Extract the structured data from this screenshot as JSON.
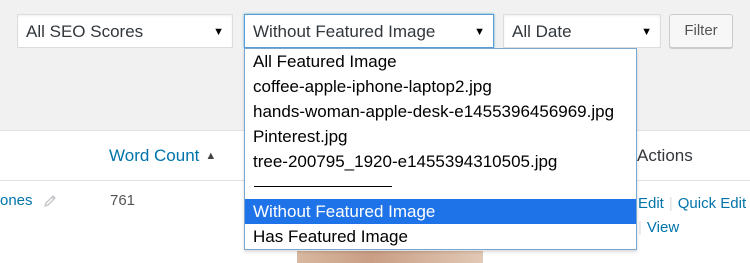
{
  "filters": {
    "seo_select": "All SEO Scores",
    "featured_select": "Without Featured Image",
    "date_select": "All Date",
    "filter_button": "Filter"
  },
  "dropdown": {
    "options": [
      "All Featured Image",
      "coffee-apple-iphone-laptop2.jpg",
      "hands-woman-apple-desk-e1455396456969.jpg",
      "Pinterest.jpg",
      "tree-200795_1920-e1455394310505.jpg",
      "───────────────",
      "Without Featured Image",
      "Has Featured Image"
    ],
    "selected_option": "Without Featured Image"
  },
  "table": {
    "columns": {
      "word_count": "Word Count",
      "actions": "Actions"
    },
    "row": {
      "title_fragment": "ones",
      "word_count": "761",
      "actions": [
        "Edit",
        "Quick Edit",
        "View"
      ]
    }
  },
  "colors": {
    "link": "#0073aa",
    "selected_option_bg": "#1e73e8",
    "focus_border": "#5b9dd9"
  },
  "icons": {
    "select_arrow": "triangle-down",
    "sort_indicator": "triangle-up",
    "edit_inline": "pencil"
  }
}
